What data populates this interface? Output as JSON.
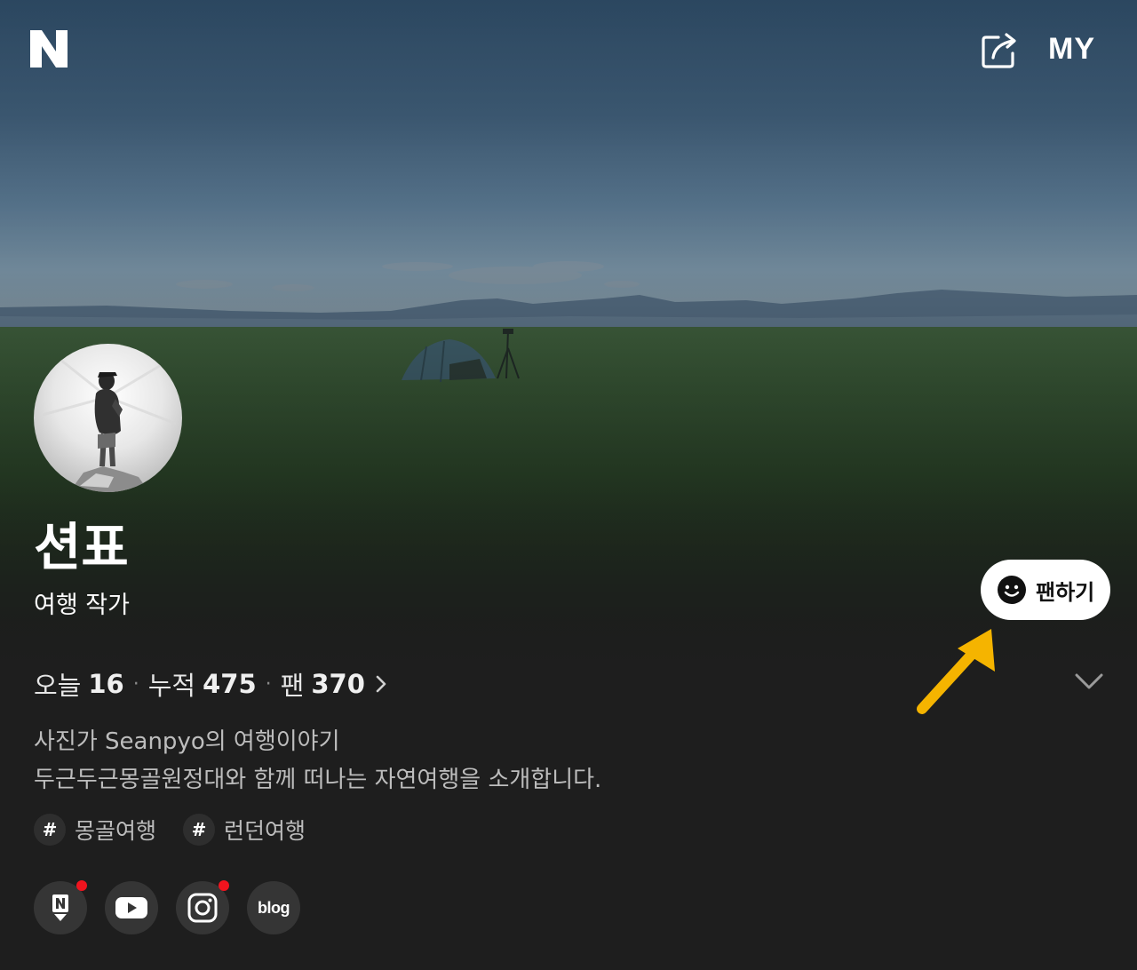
{
  "header": {
    "logo": "N",
    "share_icon": "share-icon",
    "my_label": "MY"
  },
  "profile": {
    "name": "션표",
    "role": "여행 작가",
    "fan_button_label": "팬하기",
    "fan_button_icon": "smile-icon"
  },
  "stats": {
    "today_label": "오늘",
    "today_value": "16",
    "total_label": "누적",
    "total_value": "475",
    "fans_label": "팬",
    "fans_value": "370"
  },
  "description": {
    "line1": "사진가 Seanpyo의 여행이야기",
    "line2": "두근두근몽골원정대와 함께 떠나는 자연여행을 소개합니다."
  },
  "tags": [
    {
      "label": "몽골여행"
    },
    {
      "label": "런던여행"
    }
  ],
  "socials": [
    {
      "icon": "naver-post-icon",
      "has_badge": true
    },
    {
      "icon": "youtube-icon",
      "has_badge": false
    },
    {
      "icon": "instagram-icon",
      "has_badge": true
    },
    {
      "icon": "blog-icon",
      "label": "blog",
      "has_badge": false
    }
  ],
  "annotation": {
    "arrow_color": "#f5b400",
    "badge_color": "#f0141e"
  }
}
